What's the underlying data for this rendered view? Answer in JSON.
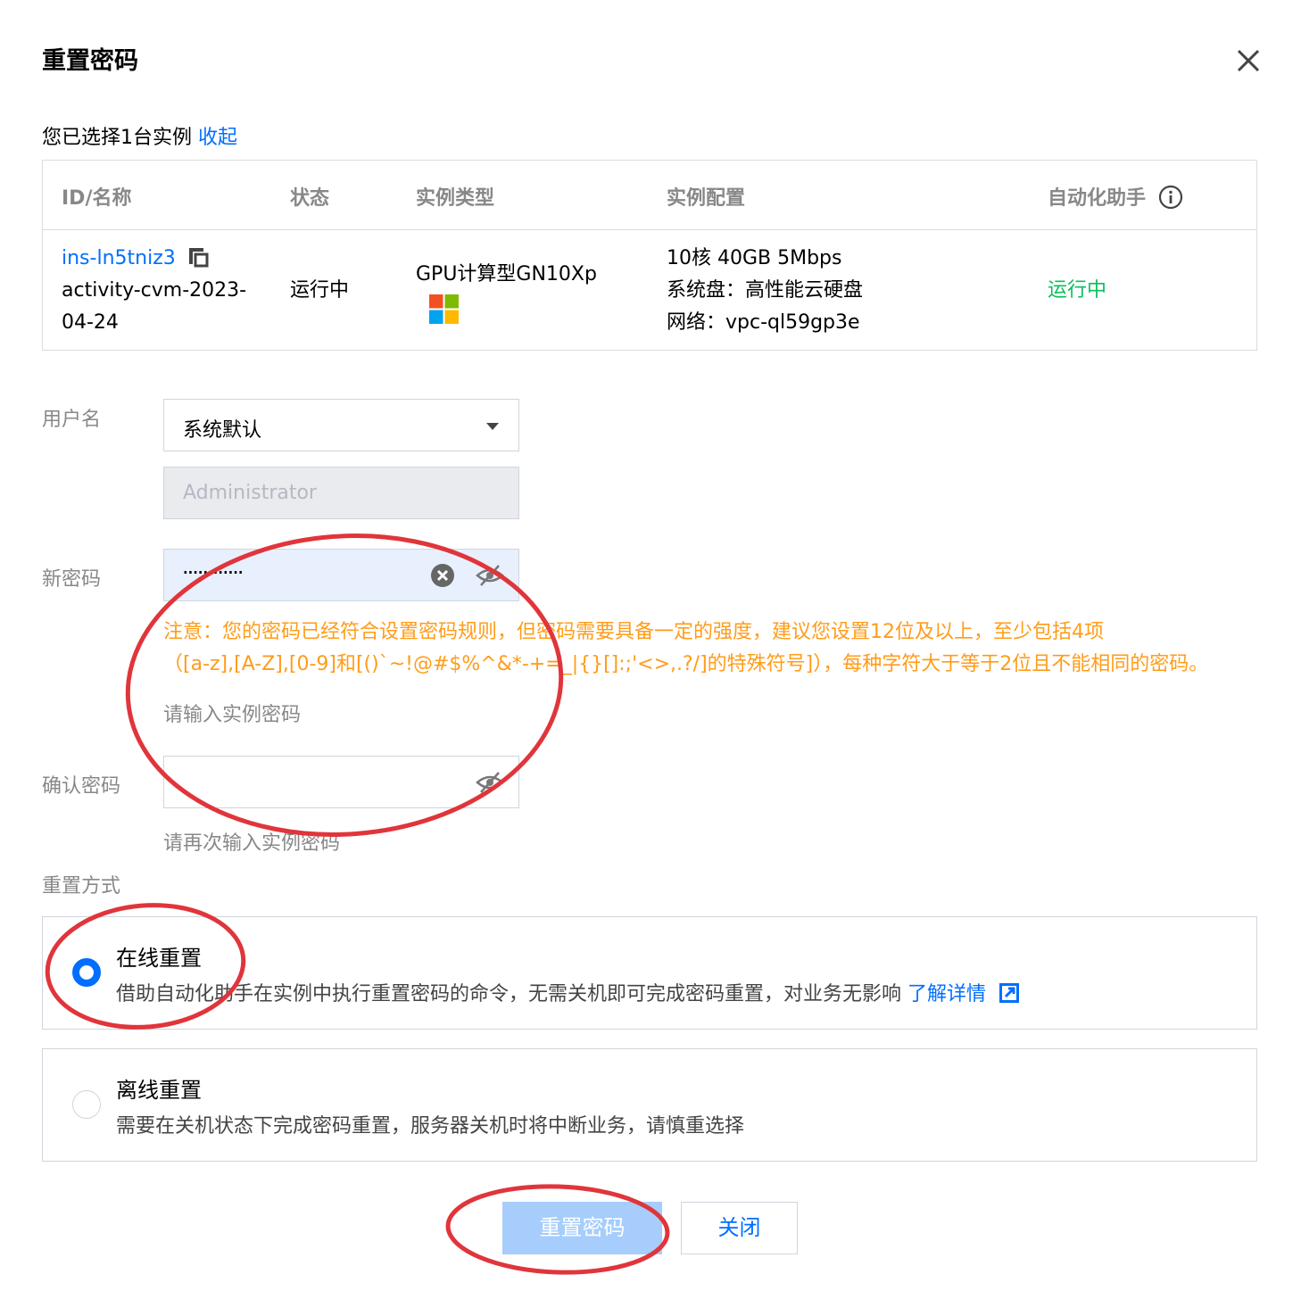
{
  "dialog": {
    "title": "重置密码",
    "selected_text": "您已选择1台实例",
    "collapse_link": "收起"
  },
  "table": {
    "headers": [
      "ID/名称",
      "状态",
      "实例类型",
      "实例配置",
      "自动化助手"
    ],
    "row": {
      "id": "ins-ln5tniz3",
      "name_line1": "activity-cvm-2023-",
      "name_line2": "04-24",
      "status": "运行中",
      "type": "GPU计算型GN10Xp",
      "os_icon": "windows-logo-icon",
      "config_line1": "10核 40GB 5Mbps",
      "config_line2": "系统盘：高性能云硬盘",
      "config_line3": "网络：vpc-ql59gp3e",
      "agent_status": "运行中"
    }
  },
  "form": {
    "username_label": "用户名",
    "username_select": "系统默认",
    "username_value": "Administrator",
    "new_password_label": "新密码",
    "new_password_masked": "············",
    "warning_line1": "注意：您的密码已经符合设置密码规则，但密码需要具备一定的强度，建议您设置12位及以上，至少包括4项",
    "warning_line2": "（[a-z],[A-Z],[0-9]和[()`~!@#$%^&*-+=_|{}[]:;'<>,.?/]的特殊符号]），每种字符大于等于2位且不能相同的密码。",
    "new_password_hint": "请输入实例密码",
    "confirm_label": "确认密码",
    "confirm_hint": "请再次输入实例密码",
    "reset_method_label": "重置方式"
  },
  "options": [
    {
      "title": "在线重置",
      "desc": "借助自动化助手在实例中执行重置密码的命令，无需关机即可完成密码重置，对业务无影响",
      "link": "了解详情",
      "selected": true
    },
    {
      "title": "离线重置",
      "desc": "需要在关机状态下完成密码重置，服务器关机时将中断业务，请慎重选择",
      "selected": false
    }
  ],
  "buttons": {
    "confirm": "重置密码",
    "close": "关闭"
  },
  "colors": {
    "accent": "#006eff",
    "warning": "#ff9c19",
    "success": "#0abf5b",
    "annotation": "#e0353b"
  }
}
